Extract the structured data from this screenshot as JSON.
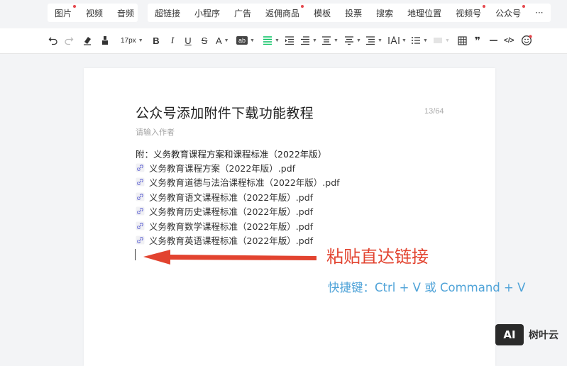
{
  "insert_bar": {
    "group1": [
      {
        "label": "图片",
        "dot": true
      },
      {
        "label": "视频",
        "dot": false
      },
      {
        "label": "音频",
        "dot": false
      }
    ],
    "group2": [
      {
        "label": "超链接",
        "dot": false
      },
      {
        "label": "小程序",
        "dot": false
      },
      {
        "label": "广告",
        "dot": false
      },
      {
        "label": "返佣商品",
        "dot": true
      },
      {
        "label": "模板",
        "dot": false
      },
      {
        "label": "投票",
        "dot": false
      },
      {
        "label": "搜索",
        "dot": false
      },
      {
        "label": "地理位置",
        "dot": false
      },
      {
        "label": "视频号",
        "dot": true
      },
      {
        "label": "公众号",
        "dot": true
      }
    ],
    "more_label": "···"
  },
  "format_bar": {
    "font_size": "17px",
    "quote_label": "❞",
    "code_label": "</>",
    "text_label": "A",
    "bg_label": "ab"
  },
  "editor": {
    "title": "公众号添加附件下载功能教程",
    "title_counter": "13/64",
    "author_placeholder": "请输入作者",
    "intro": "附：义务教育课程方案和课程标准（2022年版）",
    "attachments": [
      "义务教育课程方案（2022年版）.pdf",
      "义务教育道德与法治课程标准（2022年版）.pdf",
      "义务教育语文课程标准（2022年版）.pdf",
      "义务教育历史课程标准（2022年版）.pdf",
      "义务教育数学课程标准（2022年版）.pdf",
      "义务教育英语课程标准（2022年版）.pdf"
    ]
  },
  "annotation": {
    "main": "粘贴直达链接",
    "shortcut": "快捷键：Ctrl + V 或 Command + V",
    "main_color": "#e2432f",
    "shortcut_color": "#4fa3d8"
  },
  "watermark": {
    "box": "AI",
    "text": "树叶云"
  },
  "colors": {
    "accent_green": "#07c160",
    "dot_red": "#e5484d"
  }
}
